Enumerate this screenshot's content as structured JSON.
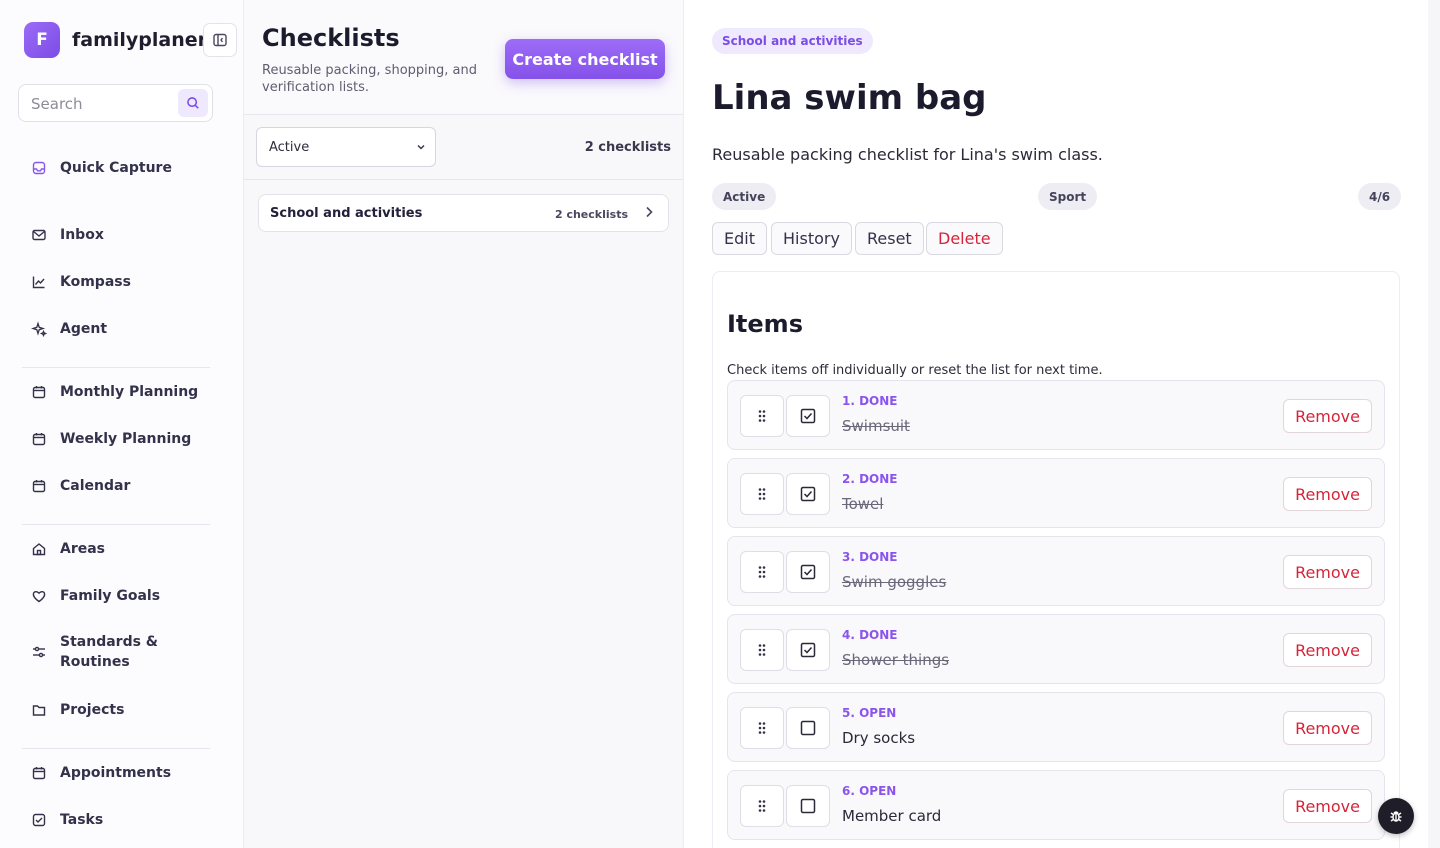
{
  "app": {
    "logo_letter": "F",
    "name": "familyplaner"
  },
  "search": {
    "placeholder": "Search"
  },
  "sidebar": {
    "items": [
      {
        "label": "Quick Capture",
        "icon": "inbox-tray-icon"
      },
      {
        "label": "Inbox",
        "icon": "mail-icon"
      },
      {
        "label": "Kompass",
        "icon": "line-chart-icon"
      },
      {
        "label": "Agent",
        "icon": "sparkles-icon"
      },
      {
        "label": "Monthly Planning",
        "icon": "calendar-icon"
      },
      {
        "label": "Weekly Planning",
        "icon": "calendar-icon"
      },
      {
        "label": "Calendar",
        "icon": "calendar-icon"
      },
      {
        "label": "Areas",
        "icon": "home-icon"
      },
      {
        "label": "Family Goals",
        "icon": "heart-icon"
      },
      {
        "label": "Standards &",
        "label2": "Routines",
        "icon": "sliders-icon"
      },
      {
        "label": "Projects",
        "icon": "folder-icon"
      },
      {
        "label": "Appointments",
        "icon": "calendar-icon"
      },
      {
        "label": "Tasks",
        "icon": "checkbox-icon"
      }
    ]
  },
  "list_panel": {
    "title": "Checklists",
    "subtitle": "Reusable packing, shopping, and verification lists.",
    "create_label": "Create checklist",
    "filter_value": "Active",
    "count_label": "2 checklists",
    "groups": [
      {
        "name": "School and activities",
        "count": "2 checklists"
      }
    ]
  },
  "detail": {
    "category": "School and activities",
    "title": "Lina swim bag",
    "description": "Reusable packing checklist for Lina's swim class.",
    "status_pill": "Active",
    "tag_pill": "Sport",
    "progress_pill": "4/6",
    "actions": {
      "edit": "Edit",
      "history": "History",
      "reset": "Reset",
      "delete": "Delete"
    },
    "items_title": "Items",
    "items_subtitle": "Check items off individually or reset the list for next time.",
    "remove_label": "Remove",
    "items": [
      {
        "status": "1. DONE",
        "name": "Swimsuit",
        "done": true
      },
      {
        "status": "2. DONE",
        "name": "Towel",
        "done": true
      },
      {
        "status": "3. DONE",
        "name": "Swim goggles",
        "done": true
      },
      {
        "status": "4. DONE",
        "name": "Shower things",
        "done": true
      },
      {
        "status": "5. OPEN",
        "name": "Dry socks",
        "done": false
      },
      {
        "status": "6. OPEN",
        "name": "Member card",
        "done": false
      }
    ]
  },
  "colors": {
    "accent": "#8552ea",
    "danger": "#d4253a"
  },
  "icons": {
    "fab": "bug-icon",
    "collapse": "sidebar-collapse-icon",
    "search": "search-icon"
  }
}
